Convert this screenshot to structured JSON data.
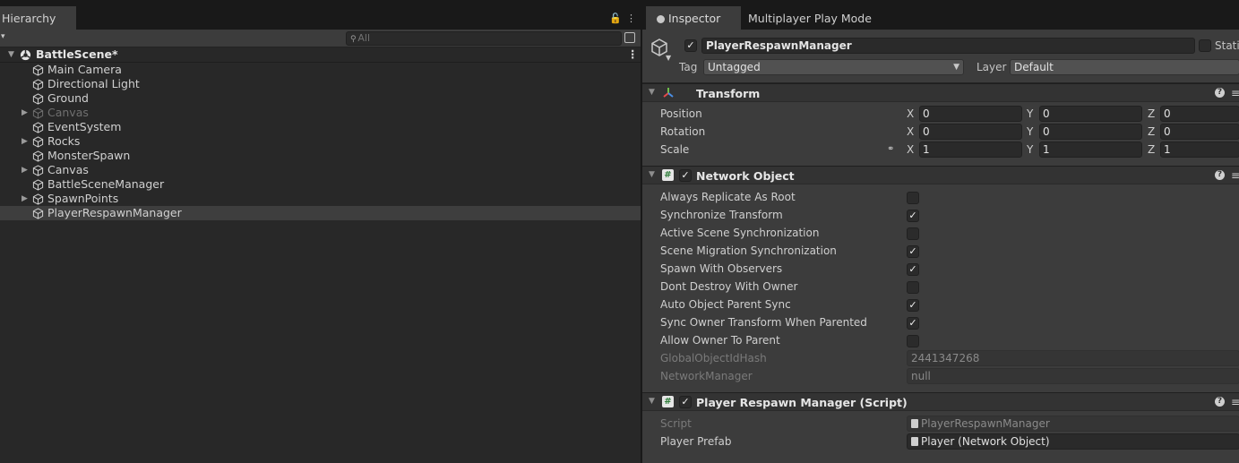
{
  "hierarchy": {
    "tab_label": "Hierarchy",
    "search_placeholder": "All",
    "scene_name": "BattleScene*",
    "items": [
      {
        "label": "Main Camera",
        "expandable": false,
        "disabled": false,
        "selected": false
      },
      {
        "label": "Directional Light",
        "expandable": false,
        "disabled": false,
        "selected": false
      },
      {
        "label": "Ground",
        "expandable": false,
        "disabled": false,
        "selected": false
      },
      {
        "label": "Canvas",
        "expandable": true,
        "disabled": true,
        "selected": false
      },
      {
        "label": "EventSystem",
        "expandable": false,
        "disabled": false,
        "selected": false
      },
      {
        "label": "Rocks",
        "expandable": true,
        "disabled": false,
        "selected": false
      },
      {
        "label": "MonsterSpawn",
        "expandable": false,
        "disabled": false,
        "selected": false
      },
      {
        "label": "Canvas",
        "expandable": true,
        "disabled": false,
        "selected": false
      },
      {
        "label": "BattleSceneManager",
        "expandable": false,
        "disabled": false,
        "selected": false
      },
      {
        "label": "SpawnPoints",
        "expandable": true,
        "disabled": false,
        "selected": false
      },
      {
        "label": "PlayerRespawnManager",
        "expandable": false,
        "disabled": false,
        "selected": true
      }
    ]
  },
  "inspector": {
    "tabs": [
      "Inspector",
      "Multiplayer Play Mode"
    ],
    "object_name": "PlayerRespawnManager",
    "active": true,
    "static_label": "Static",
    "tag_label": "Tag",
    "tag_value": "Untagged",
    "layer_label": "Layer",
    "layer_value": "Default",
    "transform": {
      "title": "Transform",
      "rows": [
        {
          "label": "Position",
          "x": "0",
          "y": "0",
          "z": "0"
        },
        {
          "label": "Rotation",
          "x": "0",
          "y": "0",
          "z": "0"
        },
        {
          "label": "Scale",
          "x": "1",
          "y": "1",
          "z": "1"
        }
      ],
      "axis_labels": [
        "X",
        "Y",
        "Z"
      ]
    },
    "network_object": {
      "title": "Network Object",
      "enabled": true,
      "flags": [
        {
          "label": "Always Replicate As Root",
          "checked": false
        },
        {
          "label": "Synchronize Transform",
          "checked": true
        },
        {
          "label": "Active Scene Synchronization",
          "checked": false
        },
        {
          "label": "Scene Migration Synchronization",
          "checked": true
        },
        {
          "label": "Spawn With Observers",
          "checked": true
        },
        {
          "label": "Dont Destroy With Owner",
          "checked": false
        },
        {
          "label": "Auto Object Parent Sync",
          "checked": true
        },
        {
          "label": "Sync Owner Transform When Parented",
          "checked": true
        },
        {
          "label": "Allow Owner To Parent",
          "checked": false
        }
      ],
      "global_hash_label": "GlobalObjectIdHash",
      "global_hash_value": "2441347268",
      "network_manager_label": "NetworkManager",
      "network_manager_value": "null"
    },
    "respawn_script": {
      "title": "Player Respawn Manager (Script)",
      "enabled": true,
      "script_label": "Script",
      "script_value": "PlayerRespawnManager",
      "prefab_label": "Player Prefab",
      "prefab_value": "Player (Network Object)"
    }
  }
}
